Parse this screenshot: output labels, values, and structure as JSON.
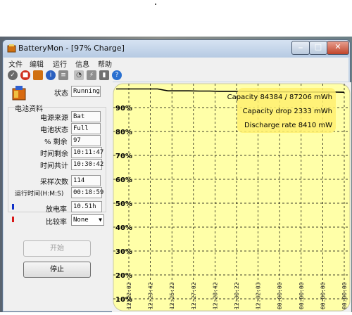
{
  "window": {
    "title": "BatteryMon - [97% Charge]"
  },
  "menu": [
    "文件",
    "编辑",
    "运行",
    "信息",
    "帮助"
  ],
  "status": {
    "label": "状态",
    "value": "Running"
  },
  "battery_info": {
    "group_title": "电池资料",
    "rows": [
      {
        "label": "电源来源",
        "value": "Bat"
      },
      {
        "label": "电池状态",
        "value": "Full"
      },
      {
        "label": "% 剩余",
        "value": "97"
      },
      {
        "label": "时间剩余",
        "value": "10:11:47"
      },
      {
        "label": "时间共计",
        "value": "10:30:42"
      }
    ]
  },
  "samples": {
    "label": "采样次数",
    "value": "114"
  },
  "runtime": {
    "label": "运行时间(H:M:S)",
    "value": "00:18:59"
  },
  "discharge": {
    "label": "放电率",
    "value": "10.51h"
  },
  "compare": {
    "label": "比较率",
    "value": "None"
  },
  "buttons": {
    "start": "开始",
    "stop": "停止"
  },
  "colors": {
    "accent_blue": "#1030c8",
    "accent_red": "#d81818",
    "chart_bg": "#ffffa8",
    "chart_line": "#000000"
  },
  "chart_data": {
    "type": "line",
    "title": "",
    "xlabel": "",
    "ylabel": "",
    "y_tick_labels": [
      "10%",
      "20%",
      "30%",
      "40%",
      "50%",
      "60%",
      "70%",
      "80%",
      "90%"
    ],
    "x_tick_labels": [
      "12:22:02",
      "12:23:42",
      "12:25:22",
      "12:27:02",
      "12:28:42",
      "12:30:22",
      "12:32:03",
      "00:00:00",
      "00:00:00",
      "00:00:00",
      "00:00:00"
    ],
    "ylim": [
      5,
      100
    ],
    "grid": true,
    "series": [
      {
        "values": [
          97.8,
          97.8,
          97.8,
          97.8,
          97.8,
          97.0,
          97.0,
          97.0,
          96.9,
          96.9,
          96.8,
          96.8,
          96.8,
          96.7,
          96.7,
          96.7,
          96.6,
          96.6,
          96.5,
          96.5,
          96.5,
          96.5,
          96.4
        ]
      }
    ],
    "annotations": [
      "Capacity 84384 / 87206 mWh",
      "Capacity drop 2333 mWh",
      "Discharge rate 8410 mW"
    ]
  }
}
